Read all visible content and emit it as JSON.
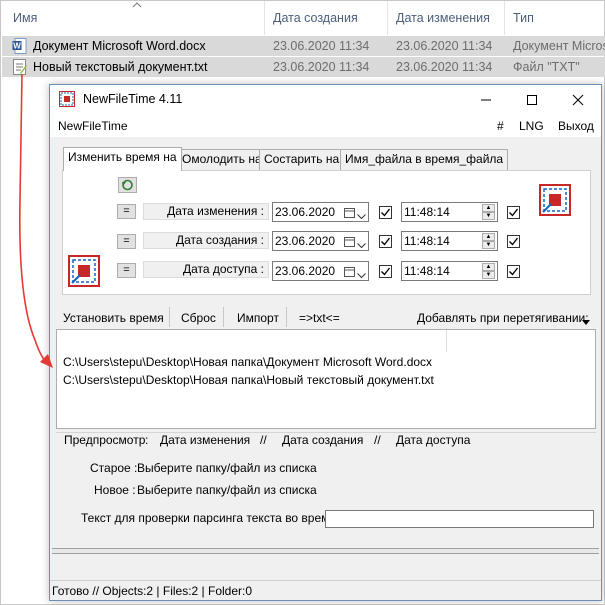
{
  "explorer": {
    "columns": [
      "Имя",
      "Дата создания",
      "Дата изменения",
      "Тип"
    ],
    "files": [
      {
        "name": "Документ Microsoft Word.docx",
        "created": "23.06.2020 11:34",
        "modified": "23.06.2020 11:34",
        "type": "Документ Micros",
        "icon": "word-doc-icon"
      },
      {
        "name": "Новый текстовый документ.txt",
        "created": "23.06.2020 11:34",
        "modified": "23.06.2020 11:34",
        "type": "Файл \"TXT\"",
        "icon": "text-doc-icon"
      }
    ]
  },
  "window": {
    "title": "NewFileTime 4.11",
    "menu": {
      "app": "NewFileTime",
      "hash": "#",
      "lng": "LNG",
      "exit": "Выход"
    },
    "tabs": [
      "Изменить время на",
      "Омолодить на",
      "Состарить на",
      "Имя_файла в время_файла"
    ],
    "rows": [
      {
        "eq": "=",
        "label": "Дата изменения :",
        "date": "23.06.2020",
        "time": "11:48:14"
      },
      {
        "eq": "=",
        "label": "Дата создания :",
        "date": "23.06.2020",
        "time": "11:48:14"
      },
      {
        "eq": "=",
        "label": "Дата доступа :",
        "date": "23.06.2020",
        "time": "11:48:14"
      }
    ],
    "actions": {
      "set_time": "Установить время",
      "reset": "Сброс",
      "import": "Импорт",
      "txt": "=>txt<=",
      "add_on_drag": "Добавлять при перетягивании:"
    },
    "file_paths": [
      "C:\\Users\\stepu\\Desktop\\Новая папка\\Документ Microsoft Word.docx",
      "C:\\Users\\stepu\\Desktop\\Новая папка\\Новый текстовый документ.txt"
    ],
    "preview": {
      "header_label": "Предпросмотр",
      "col_sep": ":",
      "col1": "Дата изменения",
      "slash1": "//",
      "col2": "Дата создания",
      "slash2": "//",
      "col3": "Дата доступа",
      "old_label": "Старое :",
      "old_value": "Выберите папку/файл из списка",
      "new_label": "Новое :",
      "new_value": "Выберите папку/файл из списка",
      "parse_label": "Текст для проверки парсинга текста во время",
      "parse_value": ""
    },
    "status": "Готово // Objects:2 | Files:2 | Folder:0"
  },
  "colors": {
    "arrow": "#e53935",
    "selection": "#d9d9d9",
    "header_text": "#4c607a",
    "window_bg": "#f0f0f0"
  }
}
